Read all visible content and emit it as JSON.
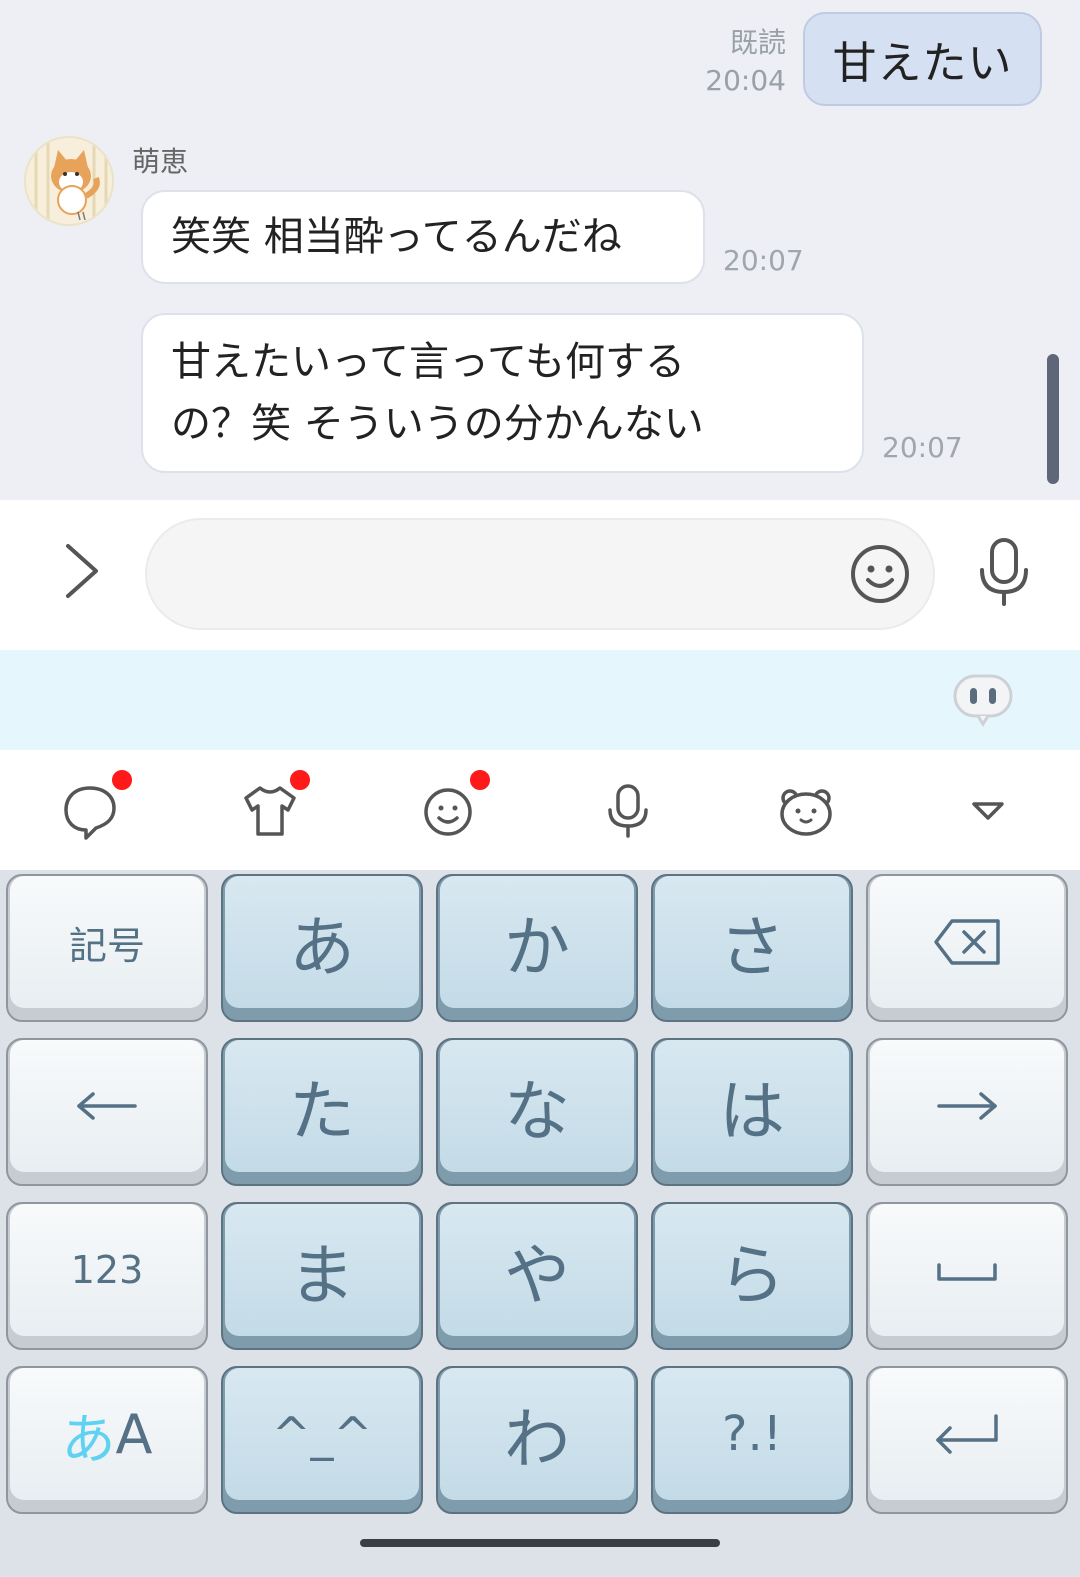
{
  "chat": {
    "outgoing": {
      "read_label": "既読",
      "time": "20:04",
      "text": "甘えたい"
    },
    "sender_name": "萌恵",
    "incoming": [
      {
        "text": "笑笑 相当酔ってるんだね",
        "time": "20:07"
      },
      {
        "line1": "甘えたいって言っても何する",
        "line2": "の？笑 そういうの分かんない",
        "time": "20:07"
      }
    ]
  },
  "input": {
    "placeholder": ""
  },
  "toolbar": {
    "icons": [
      "chat-bubble-icon",
      "shirt-icon",
      "smiley-icon",
      "microphone-icon",
      "bear-icon",
      "collapse-triangle-icon"
    ],
    "notification_color": "#ff1a1a"
  },
  "keyboard": {
    "row1": [
      "記号",
      "あ",
      "か",
      "さ",
      "⌫"
    ],
    "row2": [
      "←",
      "た",
      "な",
      "は",
      "→"
    ],
    "row3": [
      "123",
      "ま",
      "や",
      "ら",
      "␣"
    ],
    "row4": [
      "あA",
      "^_^",
      "わ",
      "?.!",
      "↵"
    ],
    "mode_kana": "あ",
    "mode_alpha": "A",
    "kaomoji": "^_^"
  },
  "colors": {
    "accent": "#5fd2f2",
    "key_text": "#557186",
    "out_bubble": "#d5e0f3"
  }
}
